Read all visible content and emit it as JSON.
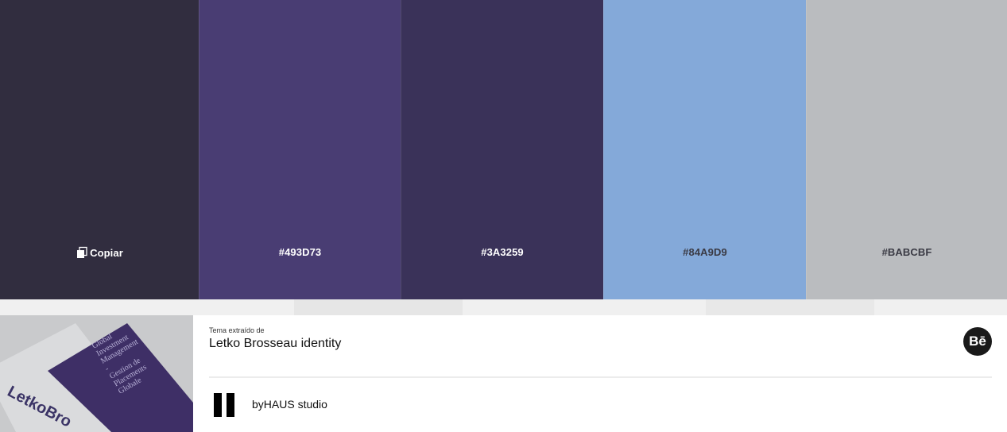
{
  "palette": {
    "swatches": [
      {
        "color": "#312D3F",
        "label": "Copiar",
        "text_tone": "light",
        "icon": "copy-icon"
      },
      {
        "color": "#493D73",
        "label": "#493D73",
        "text_tone": "light"
      },
      {
        "color": "#3A3259",
        "label": "#3A3259",
        "text_tone": "light"
      },
      {
        "color": "#84A9D9",
        "label": "#84A9D9",
        "text_tone": "dark"
      },
      {
        "color": "#BABCBF",
        "label": "#BABCBF",
        "text_tone": "dark"
      }
    ]
  },
  "theme": {
    "source_label": "Tema extraído de",
    "title": "Letko Brosseau identity",
    "author": "byHAUS studio",
    "behance_label": "Bē"
  },
  "thumbnail": {
    "brand_text": "LetkoBro",
    "card_lines": [
      "Global",
      "Investment",
      "Management",
      "-",
      "Gestion de",
      "Placements",
      "Globale"
    ],
    "card_color": "#3E2F66",
    "paper_color": "#DADBDD"
  }
}
